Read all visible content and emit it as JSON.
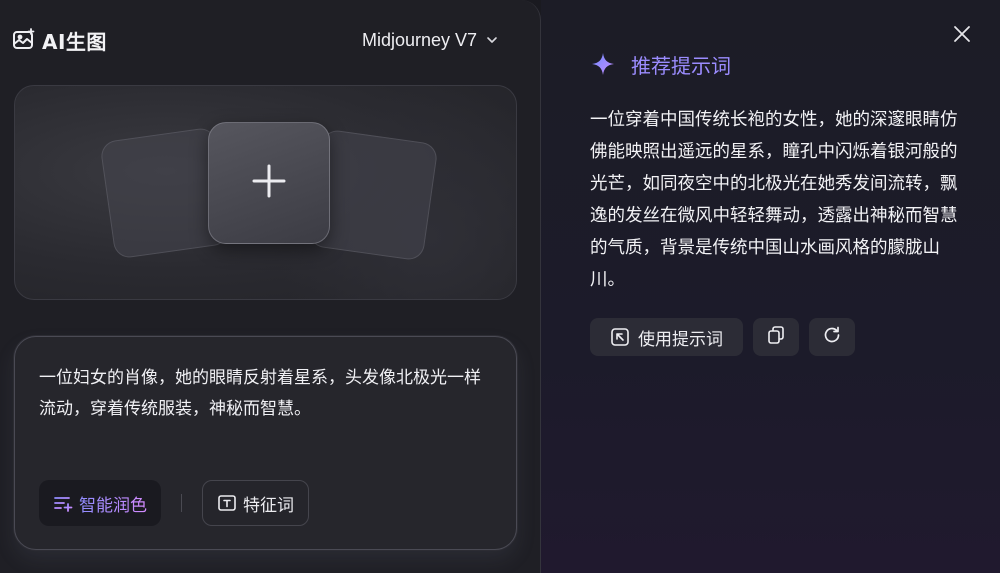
{
  "header": {
    "app_title": "AI生图",
    "app_icon": "image-sparkle-icon",
    "model_label": "Midjourney V7"
  },
  "upload": {
    "icon": "plus-icon"
  },
  "prompt": {
    "text": "一位妇女的肖像，她的眼睛反射着星系，头发像北极光一样流动，穿着传统服装，神秘而智慧。",
    "polish_label": "智能润色",
    "feature_label": "特征词"
  },
  "recommend": {
    "title": "推荐提示词",
    "text": "一位穿着中国传统长袍的女性，她的深邃眼睛仿佛能映照出遥远的星系，瞳孔中闪烁着银河般的光芒，如同夜空中的北极光在她秀发间流转，飘逸的发丝在微风中轻轻舞动，透露出神秘而智慧的气质，背景是传统中国山水画风格的朦胧山川。",
    "use_label": "使用提示词"
  },
  "colors": {
    "accent": "#9b8cff",
    "polish_gradient_start": "#8f8cff",
    "polish_gradient_end": "#d58bff"
  }
}
